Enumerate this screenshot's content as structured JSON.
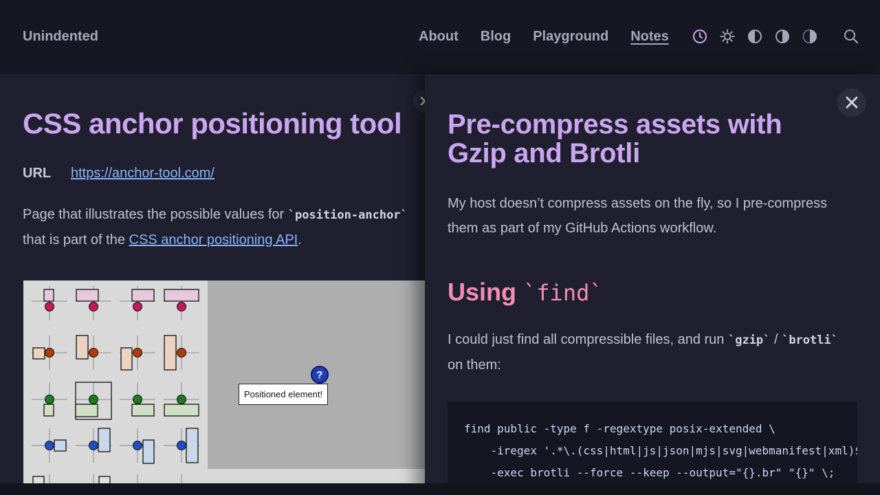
{
  "header": {
    "brand": "Unindented",
    "nav": [
      {
        "label": "About"
      },
      {
        "label": "Blog"
      },
      {
        "label": "Playground"
      },
      {
        "label": "Notes"
      }
    ],
    "icons": [
      "clock-icon",
      "sun-icon",
      "contrast-icon",
      "contrast-half-icon",
      "contrast-light-icon",
      "search-icon"
    ],
    "accent": "#cba6f0"
  },
  "left": {
    "title": "CSS anchor positioning tool",
    "url_label": "URL",
    "url": "https://anchor-tool.com/",
    "para_1": "Page that illustrates the possible values for ",
    "para_code": "`position-anchor`",
    "para_2": "that is part of the ",
    "para_link": "CSS anchor positioning API",
    "para_3": ".",
    "demo": {
      "positioned_label": "Positioned element!",
      "anchor_glyph": "?"
    }
  },
  "right": {
    "title": "Pre-compress assets with Gzip and Brotli",
    "intro": "My host doesn’t compress assets on the fly, so I pre-compress them as part of my GitHub Actions workflow.",
    "section_title_1": "Using ",
    "section_title_code": "`find`",
    "para_1": "I could just find all compressible files, and run ",
    "code_gzip": "`gzip`",
    "slash": " / ",
    "code_brotli": "`brotli`",
    "para_2": " on them:",
    "code_lines": [
      "find public -type f -regextype posix-extended \\",
      "    -iregex '.*\\.(css|html|js|json|mjs|svg|webmanifest|xml)$' \\",
      "    -exec brotli --force --keep --output=\"{}.br\" \"{}\" \\;"
    ],
    "close_label": "✕"
  }
}
